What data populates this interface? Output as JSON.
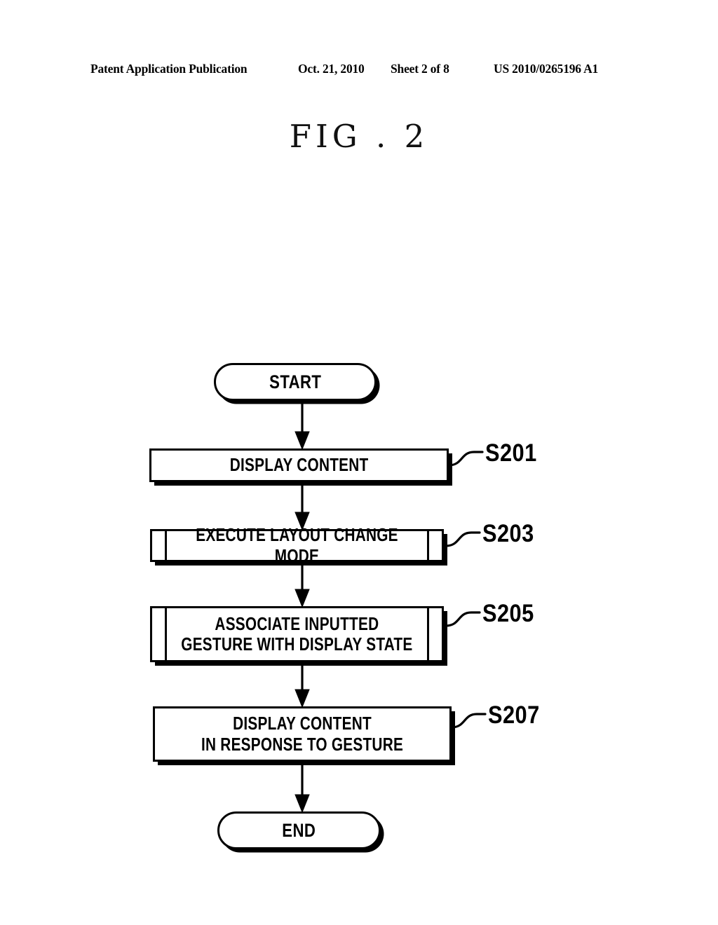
{
  "page": {
    "header": {
      "publication": "Patent Application Publication",
      "date": "Oct. 21, 2010",
      "sheet": "Sheet 2 of 8",
      "patent_number": "US 2010/0265196 A1"
    },
    "figure_title": "FIG . 2",
    "background_color": "#ffffff",
    "ink_color": "#000000"
  },
  "flowchart": {
    "nodes": [
      {
        "id": "start",
        "shape": "terminal",
        "label": "START",
        "ref": ""
      },
      {
        "id": "s201",
        "shape": "process",
        "label": "DISPLAY CONTENT",
        "ref": "S201"
      },
      {
        "id": "s203",
        "shape": "predefined-process",
        "label": "EXECUTE LAYOUT CHANGE MODE",
        "ref": "S203"
      },
      {
        "id": "s205",
        "shape": "predefined-process",
        "label": "ASSOCIATE INPUTTED\nGESTURE WITH DISPLAY STATE",
        "ref": "S205"
      },
      {
        "id": "s207",
        "shape": "process",
        "label": "DISPLAY CONTENT\nIN RESPONSE TO GESTURE",
        "ref": "S207"
      },
      {
        "id": "end",
        "shape": "terminal",
        "label": "END",
        "ref": ""
      }
    ],
    "edges": [
      {
        "from": "start",
        "to": "s201"
      },
      {
        "from": "s201",
        "to": "s203"
      },
      {
        "from": "s203",
        "to": "s205"
      },
      {
        "from": "s205",
        "to": "s207"
      },
      {
        "from": "s207",
        "to": "end"
      }
    ]
  }
}
